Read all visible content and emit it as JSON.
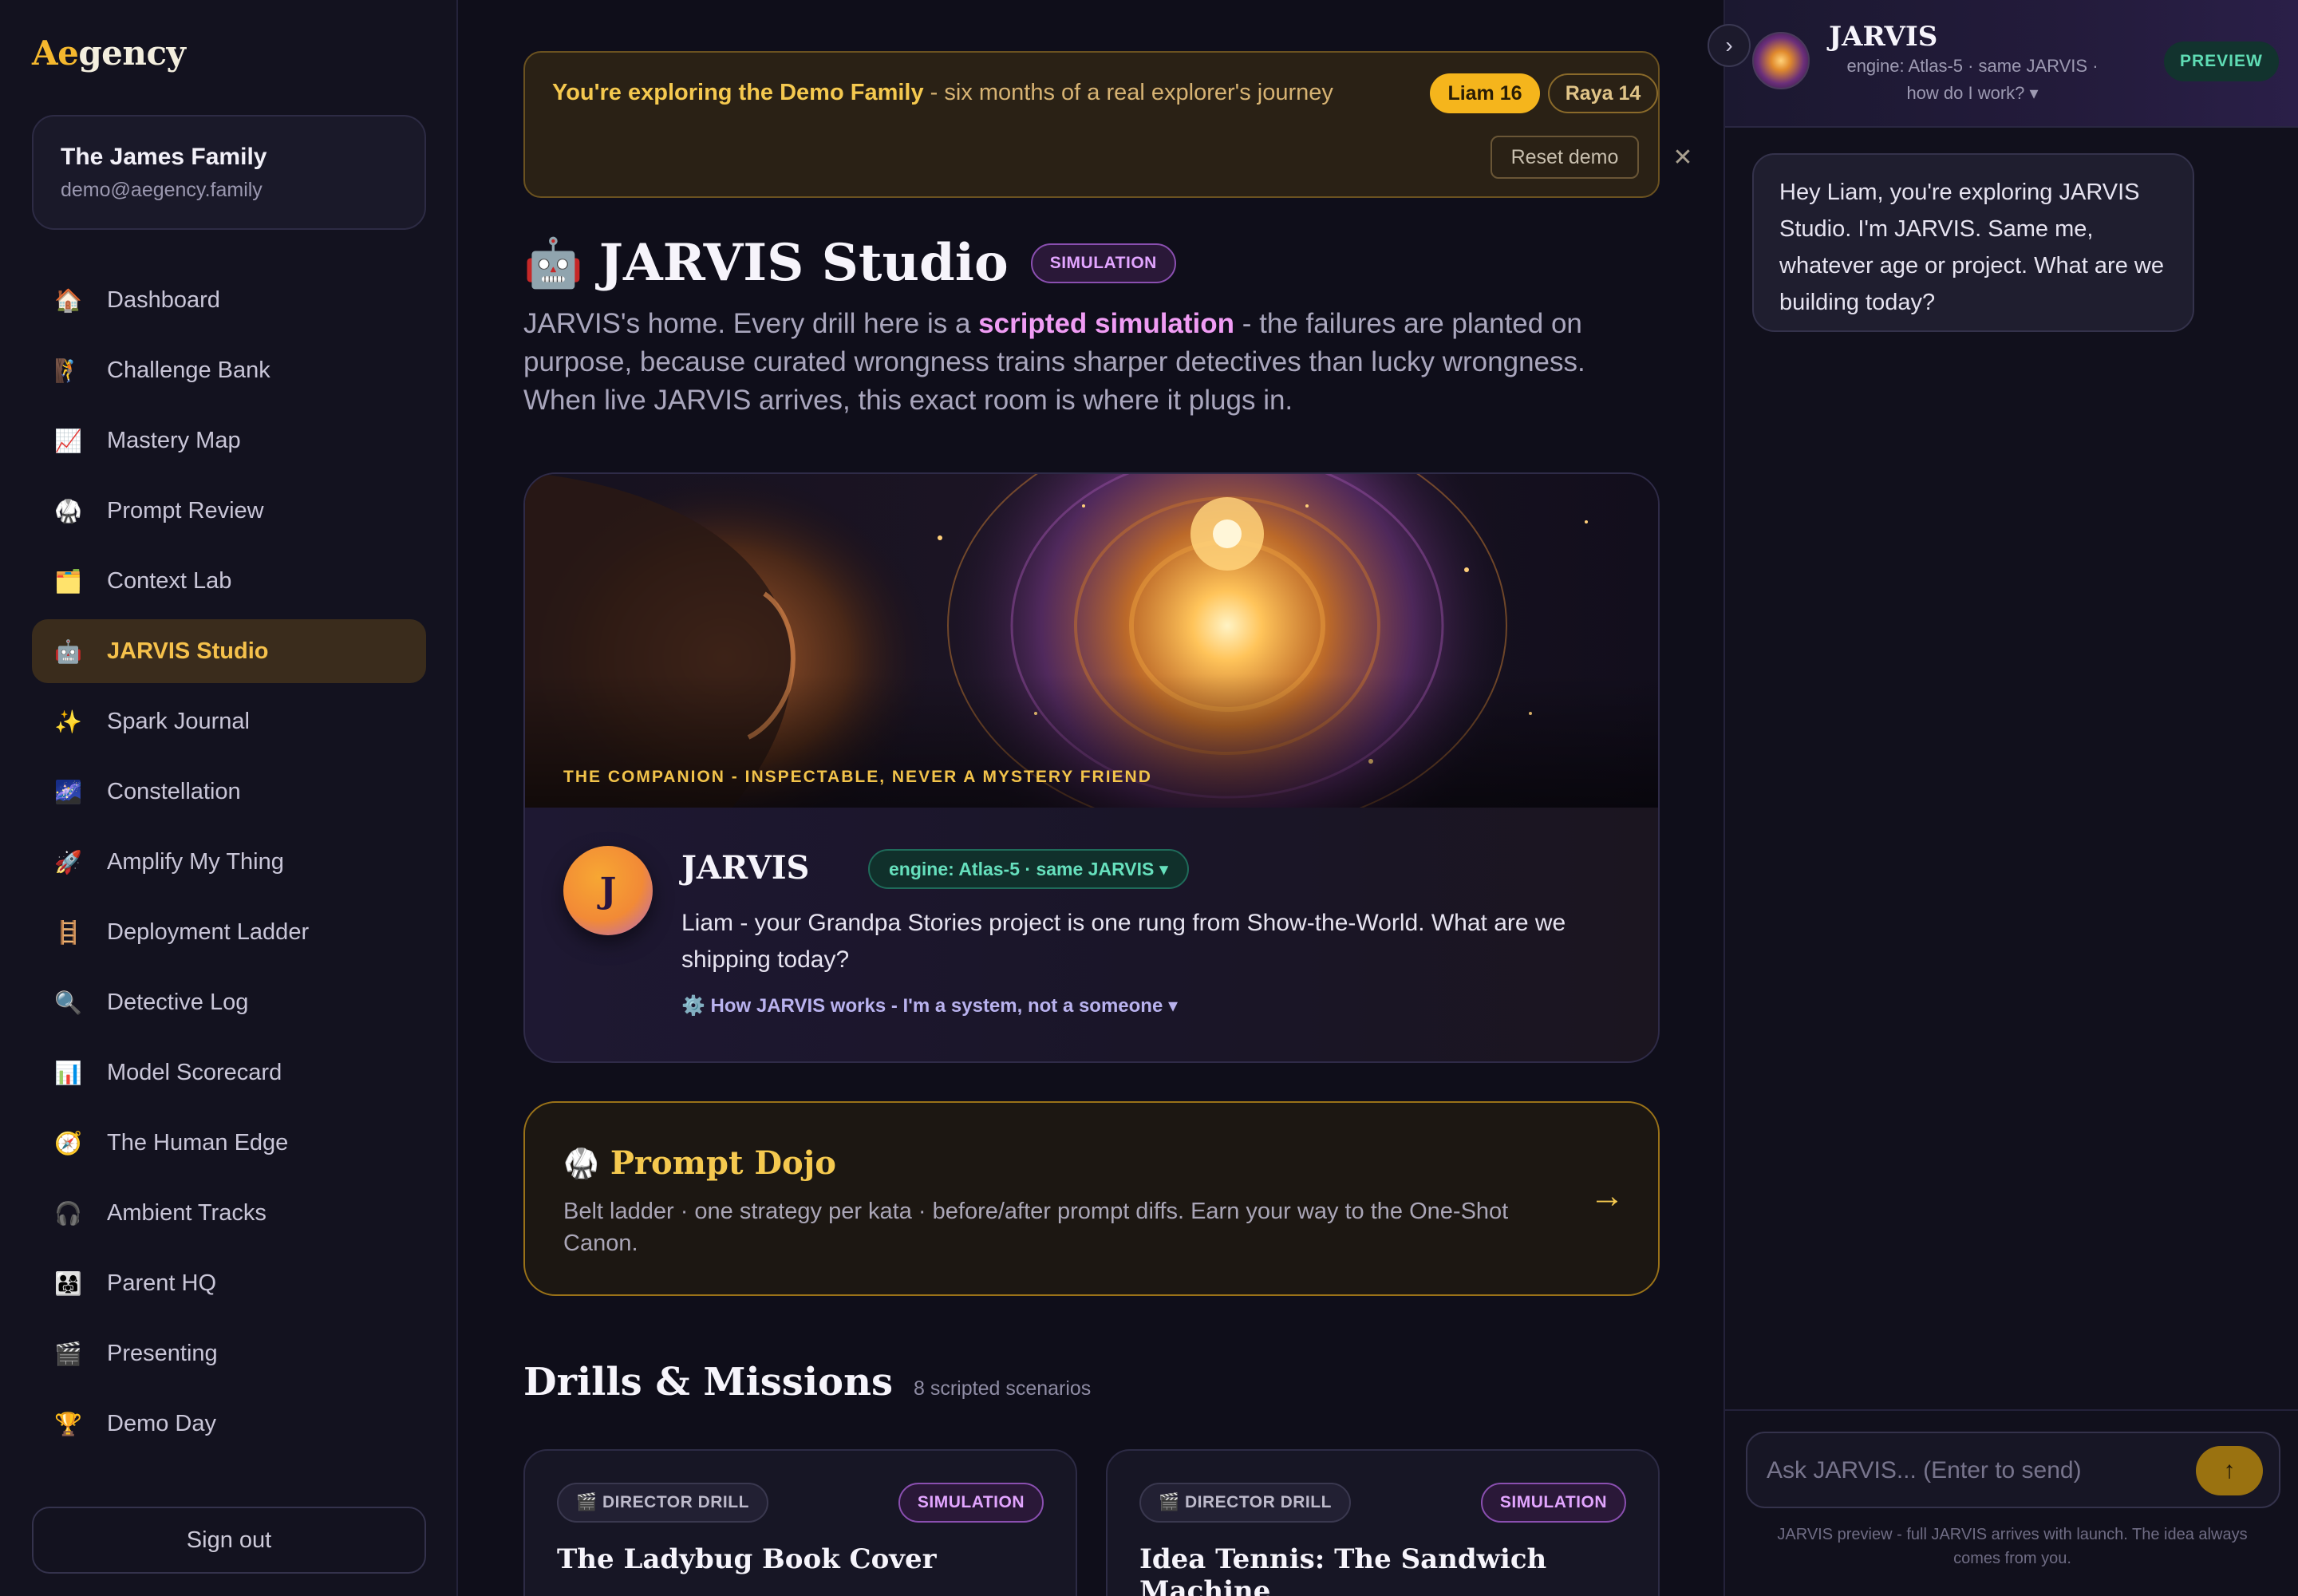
{
  "brand": {
    "logo_accent": "Ae",
    "logo_rest": "gency"
  },
  "family": {
    "name": "The James Family",
    "email": "demo@aegency.family"
  },
  "nav": [
    {
      "icon": "🏠",
      "icon_name": "house-icon",
      "label": "Dashboard",
      "active": false
    },
    {
      "icon": "🧗",
      "icon_name": "climber-icon",
      "label": "Challenge Bank",
      "active": false
    },
    {
      "icon": "📈",
      "icon_name": "chart-up-icon",
      "label": "Mastery Map",
      "active": false
    },
    {
      "icon": "🥋",
      "icon_name": "martial-arts-icon",
      "label": "Prompt Review",
      "active": false
    },
    {
      "icon": "🗂️",
      "icon_name": "folder-icon",
      "label": "Context Lab",
      "active": false
    },
    {
      "icon": "🤖",
      "icon_name": "robot-icon",
      "label": "JARVIS Studio",
      "active": true
    },
    {
      "icon": "✨",
      "icon_name": "sparkles-icon",
      "label": "Spark Journal",
      "active": false
    },
    {
      "icon": "🌌",
      "icon_name": "galaxy-icon",
      "label": "Constellation",
      "active": false
    },
    {
      "icon": "🚀",
      "icon_name": "rocket-icon",
      "label": "Amplify My Thing",
      "active": false
    },
    {
      "icon": "🪜",
      "icon_name": "ladder-icon",
      "label": "Deployment Ladder",
      "active": false
    },
    {
      "icon": "🔍",
      "icon_name": "magnifier-icon",
      "label": "Detective Log",
      "active": false
    },
    {
      "icon": "📊",
      "icon_name": "bar-chart-icon",
      "label": "Model Scorecard",
      "active": false
    },
    {
      "icon": "🧭",
      "icon_name": "compass-icon",
      "label": "The Human Edge",
      "active": false
    },
    {
      "icon": "🎧",
      "icon_name": "headphones-icon",
      "label": "Ambient Tracks",
      "active": false
    },
    {
      "icon": "👨‍👩‍👧",
      "icon_name": "family-icon",
      "label": "Parent HQ",
      "active": false
    },
    {
      "icon": "🎬",
      "icon_name": "clapper-icon",
      "label": "Presenting",
      "active": false
    },
    {
      "icon": "🏆",
      "icon_name": "trophy-icon",
      "label": "Demo Day",
      "active": false
    }
  ],
  "signout_label": "Sign out",
  "demo_banner": {
    "bold": "You're exploring the Demo Family",
    "rest": " - six months of a real explorer's journey",
    "liam": "Liam 16",
    "raya": "Raya 14",
    "reset": "Reset demo",
    "close": "✕"
  },
  "page": {
    "title_emoji": "🤖",
    "title": "JARVIS Studio",
    "badge": "SIMULATION",
    "lead_pre": "JARVIS's home. Every drill here is a ",
    "lead_bold": "scripted simulation",
    "lead_post": " - the failures are planted on purpose, because curated wrongness trains sharper detectives than lucky wrongness. When live JARVIS arrives, this exact room is where it plugs in."
  },
  "hero": {
    "kicker": "THE COMPANION - INSPECTABLE, NEVER A MYSTERY FRIEND",
    "avatar_letter": "J",
    "name": "JARVIS",
    "engine": "engine: Atlas-5 · same JARVIS ▾",
    "message": "Liam - your Grandpa Stories project is one rung from Show-the-World. What are we shipping today?",
    "how": "⚙️ How JARVIS works - I'm a system, not a someone ▾"
  },
  "dojo": {
    "emoji": "🥋",
    "title": "Prompt Dojo",
    "desc": "Belt ladder · one strategy per kata · before/after prompt diffs. Earn your way to the One-Shot Canon.",
    "arrow": "→"
  },
  "drills": {
    "title": "Drills & Missions",
    "count": "8 scripted scenarios",
    "cards": [
      {
        "tag": "🎬 DIRECTOR DRILL",
        "badge": "SIMULATION",
        "title": "The Ladybug Book Cover"
      },
      {
        "tag": "🎬 DIRECTOR DRILL",
        "badge": "SIMULATION",
        "title": "Idea Tennis: The Sandwich Machine"
      }
    ]
  },
  "panel": {
    "collapse": "›",
    "name": "JARVIS",
    "engine": "engine: Atlas-5 · same JARVIS · how do I work? ▾",
    "badge": "PREVIEW",
    "greeting": "Hey Liam, you're exploring JARVIS Studio. I'm JARVIS. Same me, whatever age or project. What are we building today?",
    "placeholder": "Ask JARVIS... (Enter to send)",
    "send": "↑",
    "footer": "JARVIS preview - full JARVIS arrives with launch. The idea always comes from you."
  }
}
